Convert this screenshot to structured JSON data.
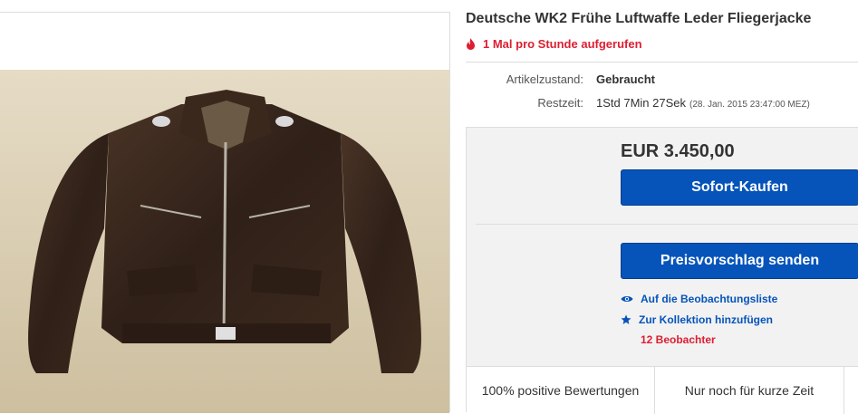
{
  "listing": {
    "title": "Deutsche WK2 Frühe Luftwaffe Leder Fliegerjacke",
    "views_note": "1 Mal pro Stunde aufgerufen",
    "condition_label": "Artikelzustand:",
    "condition_value": "Gebraucht",
    "time_label": "Restzeit:",
    "time_value": "1Std 7Min 27Sek",
    "time_end": "(28. Jan. 2015   23:47:00 MEZ)"
  },
  "purchase": {
    "price": "EUR 3.450,00",
    "buy_now_label": "Sofort-Kaufen",
    "make_offer_label": "Preisvorschlag senden",
    "watchlist_label": "Auf die Beobachtungsliste",
    "collection_label": "Zur Kollektion hinzufügen",
    "watchers": "12 Beobachter"
  },
  "features": {
    "positive": "100% positive Bewertungen",
    "limited": "Nur noch für kurze Zeit"
  },
  "colors": {
    "accent_blue": "#0654ba",
    "alert_red": "#dd1e31"
  },
  "icons": [
    "flame-icon",
    "eye-icon",
    "star-icon"
  ]
}
